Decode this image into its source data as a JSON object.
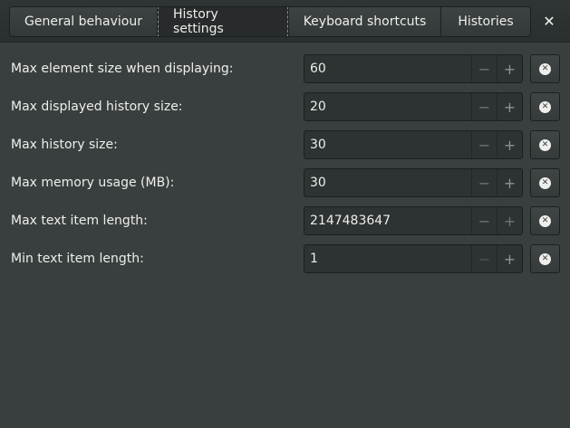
{
  "tabs": [
    {
      "label": "General behaviour"
    },
    {
      "label": "History settings"
    },
    {
      "label": "Keyboard shortcuts"
    },
    {
      "label": "Histories"
    }
  ],
  "close_glyph": "✕",
  "settings": [
    {
      "label": "Max element size when displaying:",
      "value": "60"
    },
    {
      "label": "Max displayed history size:",
      "value": "20"
    },
    {
      "label": "Max history size:",
      "value": "30"
    },
    {
      "label": "Max memory usage (MB):",
      "value": "30"
    },
    {
      "label": "Max text item length:",
      "value": "2147483647"
    },
    {
      "label": "Min text item length:",
      "value": "1"
    }
  ],
  "spin_minus_glyph": "−",
  "spin_plus_glyph": "+",
  "reset_glyph": "✕"
}
